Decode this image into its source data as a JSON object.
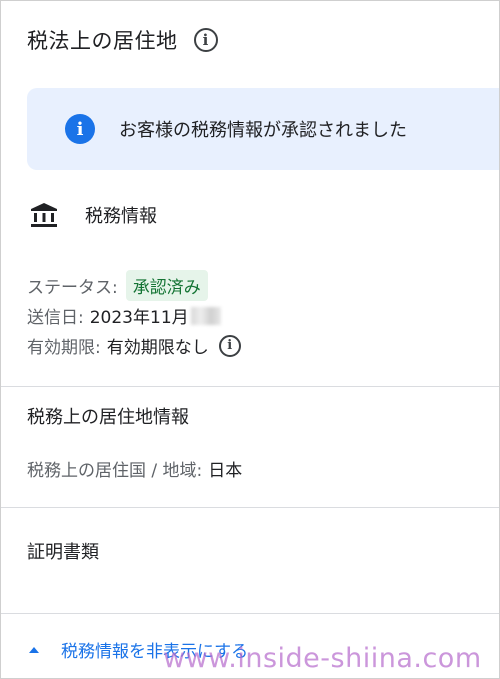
{
  "header": {
    "title": "税法上の居住地",
    "info_icon": "info-outline-icon"
  },
  "banner": {
    "message": "お客様の税務情報が承認されました",
    "icon": "info-filled-icon"
  },
  "tax_info": {
    "icon": "bank-icon",
    "title": "税務情報",
    "status_label": "ステータス:",
    "status_value": "承認済み",
    "sent_label": "送信日:",
    "sent_value": "2023年11月",
    "expiry_label": "有効期限:",
    "expiry_value": "有効期限なし"
  },
  "residence": {
    "title": "税務上の居住地情報",
    "country_label": "税務上の居住国 / 地域:",
    "country_value": "日本"
  },
  "documents": {
    "title": "証明書類"
  },
  "footer": {
    "hide_link": "税務情報を非表示にする"
  },
  "watermark": "www.inside-shiina.com",
  "colors": {
    "accent": "#1a73e8",
    "banner_bg": "#e8f0fe",
    "badge_bg": "#e6f4ea",
    "badge_text": "#137333"
  }
}
